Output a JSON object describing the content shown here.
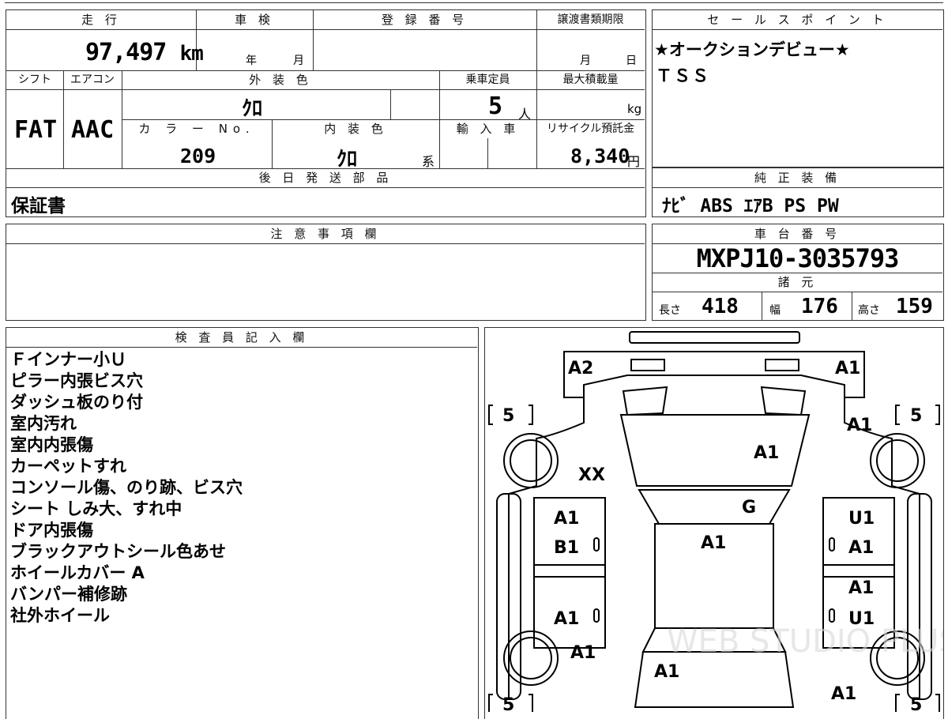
{
  "summary": {
    "mileage_header": "走 行",
    "mileage_value": "97,497",
    "mileage_unit": "km",
    "inspection_header": "車 検",
    "inspection_year_unit": "年",
    "inspection_month_unit": "月",
    "registration_header": "登 録 番 号",
    "transfer_deadline_header": "譲渡書類期限",
    "transfer_month_unit": "月",
    "transfer_day_unit": "日"
  },
  "specs": {
    "shift_header": "シフト",
    "shift_value": "FAT",
    "aircon_header": "エアコン",
    "aircon_value": "AAC",
    "exterior_color_header": "外 装 色",
    "exterior_color_value": "ｸﾛ",
    "capacity_header": "乗車定員",
    "capacity_value": "5",
    "capacity_unit": "人",
    "max_load_header": "最大積載量",
    "max_load_unit": "kg",
    "color_no_header": "カ ラ ー No.",
    "color_no_value": "209",
    "interior_color_header": "内 装 色",
    "interior_color_value": "ｸﾛ",
    "interior_color_suffix": "系",
    "import_header": "輸 入 車",
    "recycle_header": "リサイクル預託金",
    "recycle_value": "8,340",
    "recycle_unit": "円"
  },
  "later_parts": {
    "header": "後 日 発 送 部 品",
    "value": "保証書"
  },
  "sales_point": {
    "header": "セ ー ル ス ポ イ ン ト",
    "lines": [
      "★オークションデビュー★",
      "ＴＳＳ"
    ]
  },
  "genuine_equipment": {
    "header": "純 正 装 備",
    "value": "ﾅﾋﾞ ABS ｴｱB PS PW"
  },
  "notes": {
    "header": "注 意 事 項 欄",
    "value": ""
  },
  "chassis": {
    "header": "車 台 番 号",
    "value": "MXPJ10-3035793"
  },
  "dimensions": {
    "header": "諸 元",
    "length_label": "長さ",
    "length_value": "418",
    "width_label": "幅",
    "width_value": "176",
    "height_label": "高さ",
    "height_value": "159"
  },
  "inspector": {
    "header": "検 査 員 記 入 欄",
    "remarks": [
      "Ｆインナー小Ｕ",
      "ピラー内張ビス穴",
      "ダッシュ板のり付",
      "室内汚れ",
      "室内内張傷",
      "カーペットすれ",
      "コンソール傷、のり跡、ビス穴",
      "シート しみ大、すれ中",
      "ドア内張傷",
      "ブラックアウトシール色あせ",
      "ホイールカバー A",
      "バンパー補修跡",
      "社外ホイール"
    ]
  },
  "damage_map": {
    "tires": {
      "front_left": "5",
      "front_right": "5",
      "rear_left": "5",
      "rear_right": "5"
    },
    "front_bumper_left": "A2",
    "front_bumper_right": "A1",
    "right_fender": "A1",
    "hood": "A1",
    "left_fender_area": "XX",
    "windshield": "G",
    "left_front_door_upper": "A1",
    "left_front_door_lower": "B1",
    "right_front_door_upper": "U1",
    "right_front_door_lower": "A1",
    "roof": "A1",
    "right_rear_door_upper": "A1",
    "left_rear_door_lower": "A1",
    "right_rear_door_lower": "U1",
    "left_quarter": "A1",
    "right_quarter": "A1",
    "trunk": "A1",
    "watermark": "WEB STUDIO PLUS"
  }
}
